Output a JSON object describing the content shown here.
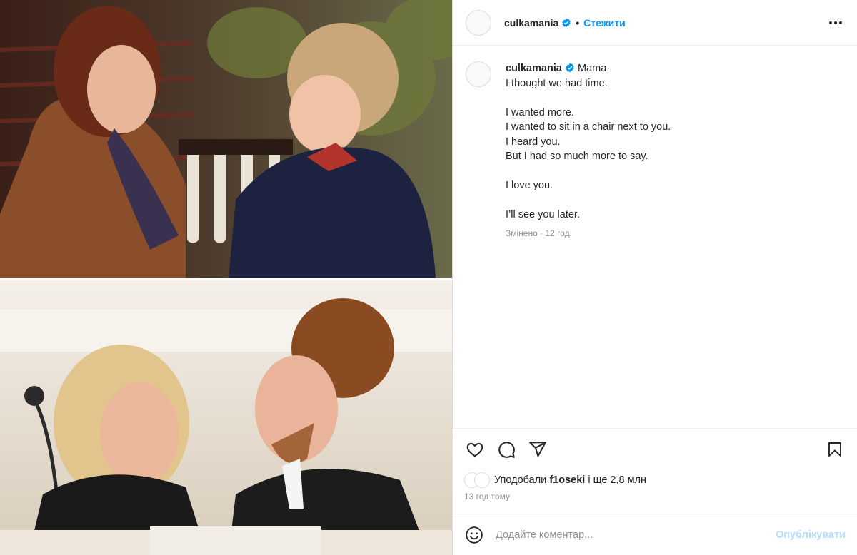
{
  "post": {
    "author": "culkamania",
    "follow_label": "Стежити",
    "dot": "•",
    "caption": {
      "username": "culkamania",
      "text": "Mama.\nI thought we had time.\n\nI wanted more.\nI wanted to sit in a chair next to you.\nI heard you.\nBut I had so much more to say.\n\nI love you.\n\nI’ll see you later."
    },
    "edited_label": "Змінено",
    "edited_sep": " · ",
    "edited_time": "12 год.",
    "likes": {
      "prefix": "Уподобали ",
      "user": "f1oseki",
      "suffix": " і ще 2,8 млн"
    },
    "timestamp": "13 год тому"
  },
  "comment": {
    "placeholder": "Додайте коментар...",
    "post_label": "Опублікувати"
  },
  "icons": {
    "verified": "verified-badge-icon",
    "more": "more-options-icon",
    "like": "heart-icon",
    "comment": "comment-icon",
    "share": "share-icon",
    "save": "bookmark-icon",
    "emoji": "emoji-icon"
  },
  "colors": {
    "accent": "#0095f6",
    "muted": "#8e8e8e",
    "post_disabled": "#b2dffc",
    "border": "#dbdbdb"
  }
}
